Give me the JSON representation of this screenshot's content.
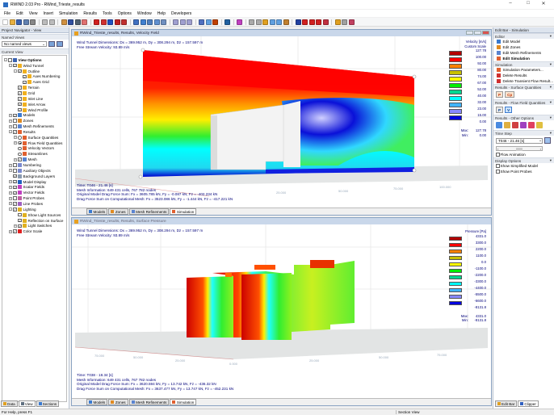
{
  "window": {
    "title": "RWIND 2.03 Pro - RWind_Trieste_results"
  },
  "menu": [
    "File",
    "Edit",
    "View",
    "Insert",
    "Simulation",
    "Results",
    "Tools",
    "Options",
    "Window",
    "Help",
    "Developers"
  ],
  "navigator": {
    "title": "Project Navigator - View",
    "named_views_label": "Named Views",
    "named_views_value": "No named views",
    "current_view_label": "Current View",
    "tree": [
      {
        "label": "View Options",
        "level": 0,
        "exp": "-",
        "ctl": "chk",
        "bold": true,
        "icon": "#3a62b0"
      },
      {
        "label": "Wind Tunnel",
        "level": 1,
        "exp": "-",
        "ctl": "chk",
        "checked": true,
        "icon": "#f0b020"
      },
      {
        "label": "Outline",
        "level": 2,
        "exp": "-",
        "ctl": "chk",
        "checked": true,
        "icon": "#f0b020"
      },
      {
        "label": "Axes Numbering",
        "level": 3,
        "ctl": "chk",
        "checked": true,
        "icon": "#f0b020"
      },
      {
        "label": "Axes Grid",
        "level": 3,
        "ctl": "chk",
        "checked": true,
        "icon": "#f0b020"
      },
      {
        "label": "Terrain",
        "level": 2,
        "ctl": "chk",
        "checked": true,
        "icon": "#f0b020"
      },
      {
        "label": "Grid",
        "level": 2,
        "ctl": "chk",
        "checked": true,
        "icon": "#f0b020"
      },
      {
        "label": "Inlet Line",
        "level": 2,
        "ctl": "chk",
        "checked": true,
        "icon": "#f0b020"
      },
      {
        "label": "Inlet Arrow",
        "level": 2,
        "ctl": "chk",
        "checked": true,
        "icon": "#f0b020"
      },
      {
        "label": "Wind Profile",
        "level": 2,
        "ctl": "chk",
        "checked": true,
        "icon": "#f0b020"
      },
      {
        "label": "Models",
        "level": 1,
        "exp": "+",
        "ctl": "chk",
        "checked": true,
        "icon": "#3a7ad0"
      },
      {
        "label": "Zones",
        "level": 1,
        "exp": "+",
        "ctl": "chk",
        "icon": "#e08a20"
      },
      {
        "label": "Mesh Refinements",
        "level": 1,
        "exp": "+",
        "ctl": "chk",
        "icon": "#5a84d0"
      },
      {
        "label": "Results",
        "level": 1,
        "exp": "-",
        "ctl": "chk",
        "checked": true,
        "icon": "#e06030"
      },
      {
        "label": "Surface Quantities",
        "level": 2,
        "exp": "+",
        "ctl": "rad",
        "icon": "#e06030"
      },
      {
        "label": "Flow Field Quantities",
        "level": 2,
        "exp": "+",
        "ctl": "rad",
        "checked": true,
        "icon": "#e06030"
      },
      {
        "label": "Velocity Vectors",
        "level": 2,
        "ctl": "rad",
        "icon": "#e06030"
      },
      {
        "label": "Streamlines",
        "level": 2,
        "ctl": "rad",
        "icon": "#e06030"
      },
      {
        "label": "Mesh",
        "level": 2,
        "exp": "+",
        "ctl": "chk",
        "checked": true,
        "icon": "#5a84d0"
      },
      {
        "label": "Numbering",
        "level": 1,
        "exp": "+",
        "ctl": "chk",
        "icon": "#7a8ad0"
      },
      {
        "label": "Auxiliary Objects",
        "level": 1,
        "exp": "+",
        "ctl": "chk",
        "icon": "#7a8ad0"
      },
      {
        "label": "Background Layers",
        "level": 1,
        "ctl": "chk",
        "checked": true,
        "icon": "#8a9ab0"
      },
      {
        "label": "Model Display",
        "level": 1,
        "exp": "+",
        "ctl": "chk",
        "checked": true,
        "icon": "#2060c0"
      },
      {
        "label": "Scalar Fields",
        "level": 1,
        "exp": "+",
        "ctl": "chk",
        "checked": true,
        "icon": "#c040c0"
      },
      {
        "label": "Vector Fields",
        "level": 1,
        "exp": "+",
        "ctl": "chk",
        "checked": true,
        "icon": "#c040c0"
      },
      {
        "label": "Point Probes",
        "level": 1,
        "exp": "+",
        "ctl": "chk",
        "icon": "#c060a0"
      },
      {
        "label": "Line Probes",
        "level": 1,
        "exp": "+",
        "ctl": "chk",
        "checked": true,
        "icon": "#a060c0"
      },
      {
        "label": "Lighting",
        "level": 1,
        "exp": "-",
        "ctl": "chk",
        "checked": true,
        "icon": "#e0b020"
      },
      {
        "label": "Show Light Sources",
        "level": 2,
        "ctl": "chk",
        "icon": "#e0b020"
      },
      {
        "label": "Reflection on Surface",
        "level": 2,
        "ctl": "chk",
        "checked": true,
        "icon": "#e0b020"
      },
      {
        "label": "Light Switches",
        "level": 2,
        "exp": "+",
        "ctl": "chk",
        "checked": true,
        "icon": "#e0b020"
      },
      {
        "label": "Color Scale",
        "level": 1,
        "exp": "+",
        "ctl": "chk",
        "checked": true,
        "icon": "#e02020"
      }
    ],
    "tabs": [
      "Data",
      "View",
      "Sections"
    ]
  },
  "view_top": {
    "title": "RWind_Trieste_results, Results, Velocity Field",
    "dimensions": "Wind Tunnel Dimensions: Dx = 369.952 m, Dy = 308.294 m, Dz = 157.597 m",
    "free_stream": "Free Stream Velocity: 93.89 m/s",
    "time": "Time: T046 - 21.46 [s]",
    "mesh": "Mesh Information: 649 431 cells, 767 782 nodes",
    "drag_model": "Original Model Drag Force Sum: Fx = 3605.785 kN, Fy = -0.087 kN, Fz = -402.234 kN",
    "drag_mesh": "Drag Force Sum on Computational Mesh: Fx = 3523.086 kN, Fy = -1.444 kN, Fz = -417.221 kN",
    "axis_labels": [
      "25.000",
      "50.000",
      "75.000",
      "100.000"
    ],
    "legend": {
      "title": "Velocity [m/s]",
      "subtitle": "Custom Scale",
      "values": [
        "127.78",
        "100.00",
        "92.00",
        "80.00",
        "74.00",
        "67.00",
        "52.00",
        "40.00",
        "32.00",
        "23.00",
        "15.00",
        "0.00"
      ],
      "colors": [
        "#b40000",
        "#ff0000",
        "#ff8000",
        "#c8c000",
        "#ffff00",
        "#00ee00",
        "#00d890",
        "#00ffff",
        "#40b4ff",
        "#8888ff",
        "#0000e0"
      ],
      "max_label": "Max:",
      "max": "127.78",
      "min_label": "Min:",
      "min": "0.00"
    }
  },
  "view_bottom": {
    "title": "RWind_Trieste_results, Results, Surface Pressure",
    "dimensions": "Wind Tunnel Dimensions: Dx = 369.952 m, Dy = 308.294 m, Dz = 157.597 m",
    "free_stream": "Free Stream Velocity: 93.89 m/s",
    "time": "Time: T038 - 18.34 [s]",
    "mesh": "Mesh Information: 649 431 cells, 767 782 nodes",
    "drag_model": "Original Model Drag Force Sum: Fx = 3620.594 kN, Fy = 13.742 kN, Fz = -436.32 kN",
    "drag_mesh": "Drag Force Sum on Computational Mesh: Fx = 3637.477 kN, Fy = 13.747 kN, Fz = -452.231 kN",
    "axis_labels": [
      "75.000",
      "50.000",
      "25.000",
      "0.000",
      "25.000",
      "50.000",
      "75.000"
    ],
    "legend": {
      "title": "Pressure [Pa]",
      "values": [
        "4331.0",
        "3300.0",
        "2200.0",
        "1100.0",
        "0.0",
        "-1100.0",
        "-2200.0",
        "-3300.0",
        "-4400.0",
        "-5500.0",
        "-6600.0",
        "-8131.8"
      ],
      "colors": [
        "#b40000",
        "#ff0000",
        "#ff8000",
        "#c8c000",
        "#ffff00",
        "#00ee00",
        "#00d890",
        "#00ffff",
        "#40b4ff",
        "#8888ff",
        "#0000e0"
      ],
      "max_label": "Max:",
      "max": "4331.0",
      "min_label": "Min:",
      "min": "-8131.8"
    }
  },
  "view_tabs": [
    "Models",
    "Zones",
    "Mesh Refinements",
    "Simulation"
  ],
  "editbar": {
    "title": "Edit Bar - Simulation",
    "editor_label": "Editor",
    "editor_items": [
      "Edit Model",
      "Edit Zones",
      "Edit Mesh Refinements",
      "Edit Simulation"
    ],
    "simulation_label": "Simulation",
    "simulation_items": [
      "Simulation Parameters...",
      "Delete Results",
      "Delete Transient Flow Result..."
    ],
    "surface_label": "Results - Surface Quantities",
    "surface_buttons": [
      "P",
      "Cp"
    ],
    "flow_label": "Results - Flow Field Quantities",
    "flow_buttons": [
      "P",
      "V"
    ],
    "other_label": "Results - Other Options",
    "timestep_label": "Time Step",
    "timestep_value": "T046 - 21.46 [s]",
    "flow_animation": "Flow Animation",
    "display_label": "Display Options",
    "display_items": [
      "Show Simplified Model",
      "Show Point Probes"
    ],
    "tabs": [
      "Edit Bar",
      "Clipper"
    ]
  },
  "status": {
    "help": "For Help, press F1",
    "section": "Section View"
  }
}
